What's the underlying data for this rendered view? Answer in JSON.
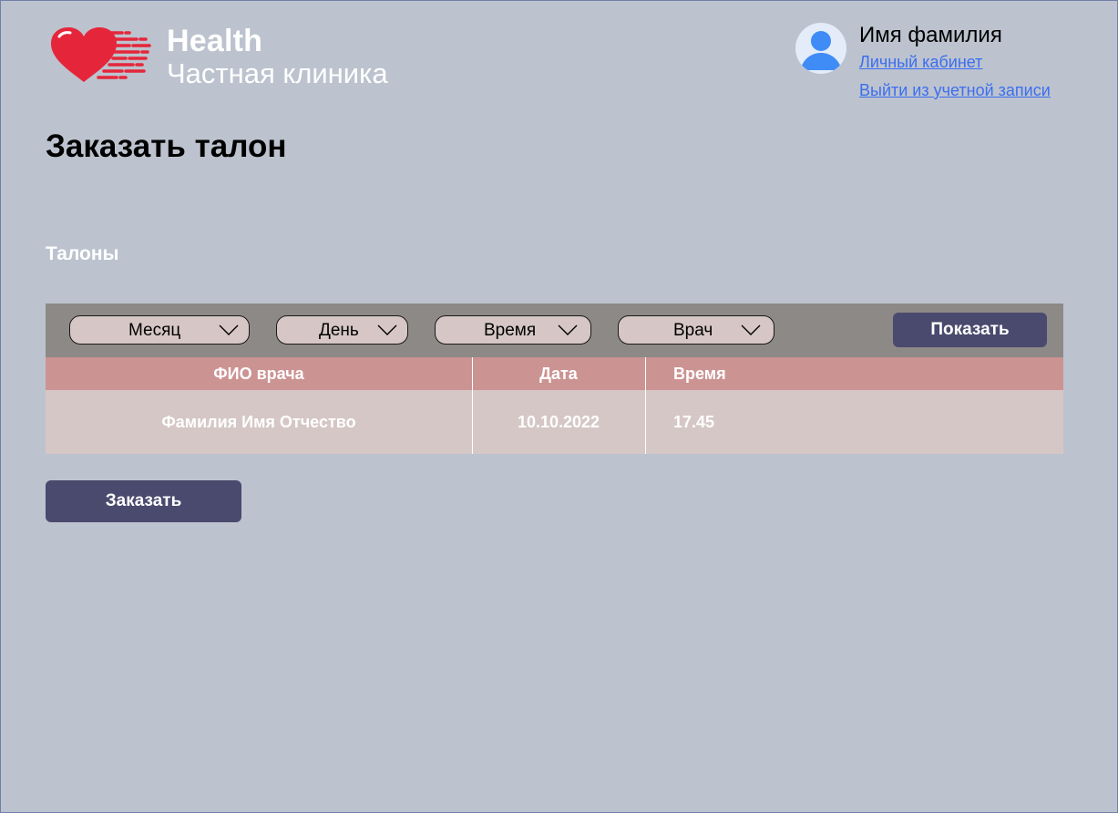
{
  "brand": {
    "title": "Health",
    "subtitle": "Частная клиника",
    "logo_icon": "heart-speed-icon",
    "logo_color": "#e5263a"
  },
  "user": {
    "name": "Имя фамилия",
    "avatar_icon": "user-avatar-icon",
    "cabinet_link": "Личный кабинет",
    "logout_link": "Выйти из учетной записи"
  },
  "page": {
    "title": "Заказать талон",
    "section_title": "Талоны"
  },
  "filters": {
    "month": "Месяц",
    "day": "День",
    "time": "Время",
    "doctor": "Врач",
    "show_button": "Показать"
  },
  "table": {
    "headers": [
      "ФИО врача",
      "Дата",
      "Время"
    ],
    "rows": [
      [
        "Фамилия Имя Отчество",
        "10.10.2022",
        "17.45"
      ]
    ]
  },
  "order_button": "Заказать",
  "colors": {
    "background": "#bcc3ce",
    "button": "#4a496e",
    "table_header": "#cc9393",
    "table_row": "#d5c7c6",
    "filter_bar": "#8d8987",
    "link": "#3c6ef0"
  }
}
